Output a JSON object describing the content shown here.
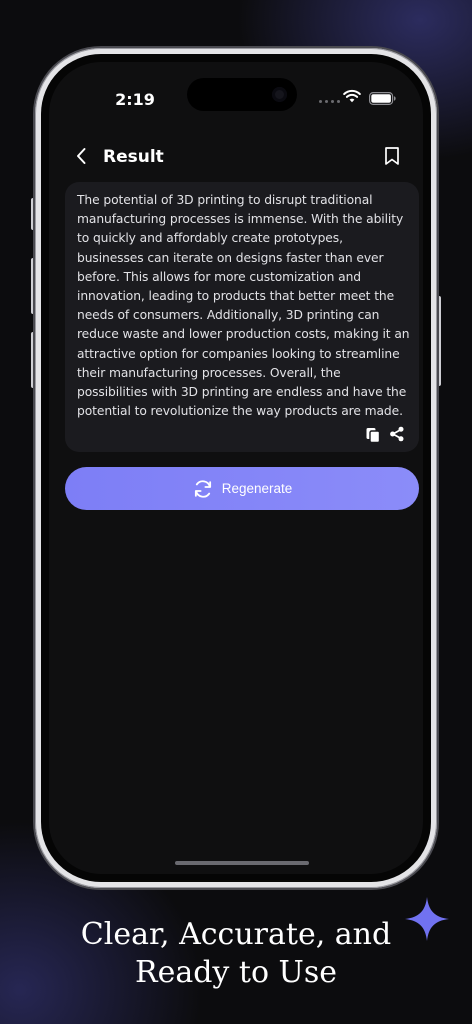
{
  "status_bar": {
    "time": "2:19"
  },
  "header": {
    "title": "Result"
  },
  "result": {
    "text": "The potential of 3D printing to disrupt traditional manufacturing processes is immense. With the ability to quickly and affordably create prototypes, businesses can iterate on designs faster than ever before. This allows for more customization and innovation, leading to products that better meet the needs of consumers. Additionally, 3D printing can reduce waste and lower production costs, making it an attractive option for companies looking to streamline their manufacturing processes. Overall, the possibilities with 3D printing are endless and have the potential to revolutionize the way products are made."
  },
  "actions": {
    "regenerate_label": "Regenerate"
  },
  "caption": {
    "line1": "Clear, Accurate, and",
    "line2": "Ready to Use"
  },
  "icons": {
    "back": "chevron-left-icon",
    "bookmark": "bookmark-icon",
    "copy": "copy-icon",
    "share": "share-icon",
    "regenerate": "refresh-icon",
    "sparkle": "sparkle-icon"
  },
  "colors": {
    "accent": "#8283f8",
    "card_background": "#1b1b1f",
    "screen_background": "#0f0f10",
    "sparkle": "#7172f0"
  }
}
